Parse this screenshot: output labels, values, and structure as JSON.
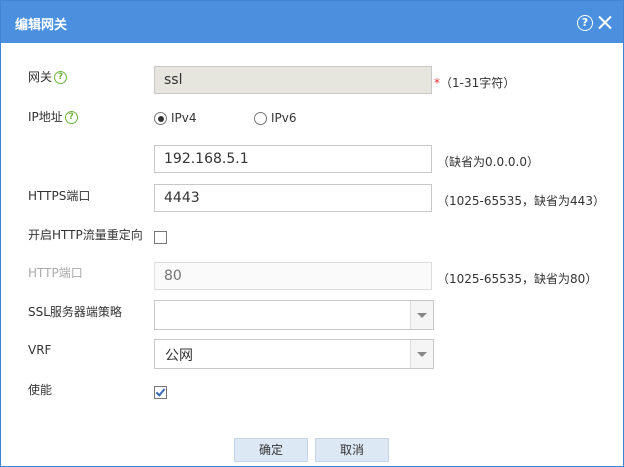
{
  "dialog": {
    "title": "编辑网关",
    "help_icon": "question-circle-icon",
    "close_icon": "close-icon"
  },
  "gateway": {
    "label": "网关",
    "value": "ssl",
    "required_mark": "*",
    "hint": "（1-31字符）"
  },
  "ip": {
    "label": "IP地址",
    "ipv4_label": "IPv4",
    "ipv6_label": "IPv6",
    "selected": "IPv4",
    "value": "192.168.5.1",
    "hint": "（缺省为0.0.0.0）"
  },
  "https_port": {
    "label": "HTTPS端口",
    "value": "4443",
    "hint": "（1025-65535，缺省为443）"
  },
  "http_redirect": {
    "label": "开启HTTP流量重定向",
    "checked": false
  },
  "http_port": {
    "label": "HTTP端口",
    "placeholder": "80",
    "hint": "（1025-65535，缺省为80）"
  },
  "ssl_policy": {
    "label": "SSL服务器端策略",
    "value": ""
  },
  "vrf": {
    "label": "VRF",
    "value": "公网"
  },
  "enable": {
    "label": "使能",
    "checked": true
  },
  "buttons": {
    "ok": "确定",
    "cancel": "取消"
  },
  "colors": {
    "titlebar": "#4a90df",
    "help_icon": "#6cb33f",
    "required": "#e23030"
  }
}
